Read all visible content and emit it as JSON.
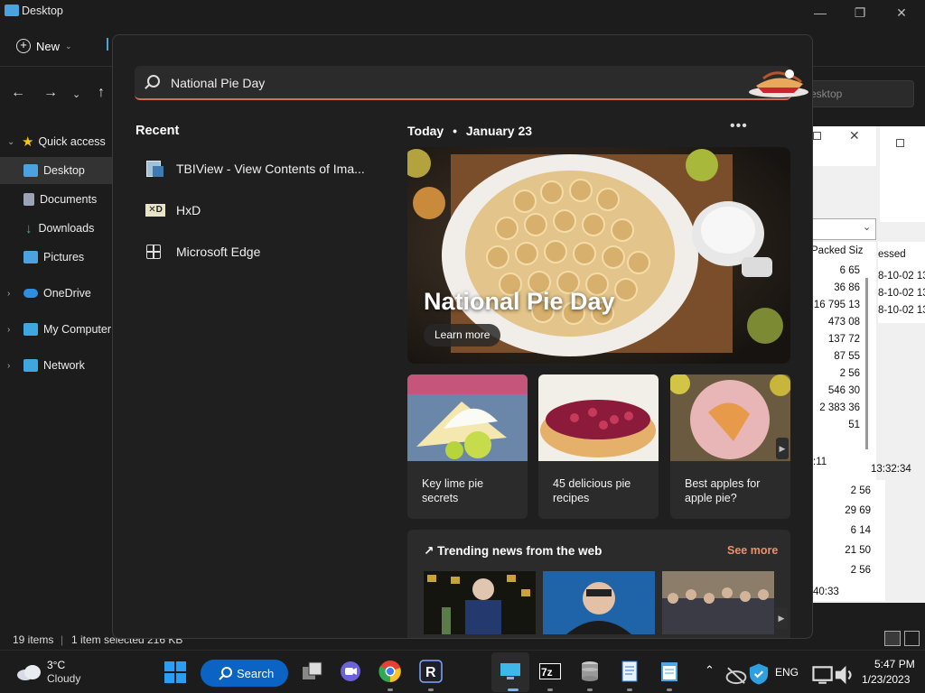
{
  "explorer": {
    "title": "Desktop",
    "new_label": "New",
    "search_placeholder": "esktop",
    "sidebar": [
      {
        "label": "Quick access",
        "icon": "star-icon",
        "color": "#f2c811"
      },
      {
        "label": "Desktop",
        "icon": "desktop-icon",
        "color": "#4aa3df"
      },
      {
        "label": "Documents",
        "icon": "documents-icon",
        "color": "#9aa4b4"
      },
      {
        "label": "Downloads",
        "icon": "download-icon",
        "color": "#3fb37f"
      },
      {
        "label": "Pictures",
        "icon": "pictures-icon",
        "color": "#4aa3df"
      },
      {
        "label": "OneDrive",
        "icon": "cloud-icon",
        "color": "#2f8ee0"
      },
      {
        "label": "My Computer",
        "icon": "computer-icon",
        "color": "#3fa7e0"
      },
      {
        "label": "Network",
        "icon": "network-icon",
        "color": "#3fa7e0"
      }
    ],
    "status": {
      "items": "19 items",
      "selected": "1 item selected",
      "size": "216 KB"
    }
  },
  "zip_window": {
    "col_packed": "Packed Siz",
    "col_modified": "essed",
    "packed_values": [
      "6 65",
      "36 86",
      "16 795 13",
      "473 08",
      "137 72",
      "87 55",
      "2 56",
      "546 30",
      "2 383 36",
      "51"
    ],
    "dates": [
      "8-10-02 13",
      "8-10-02 13",
      "8-10-02 13"
    ],
    "footer_left": ":11",
    "footer_right": "13:32:34",
    "lower_values": [
      "2 56",
      "29 69",
      "6 14",
      "21 50",
      "2 56"
    ],
    "lower_footer": "40:33"
  },
  "search": {
    "query": "National Pie Day",
    "recent_title": "Recent",
    "recent": [
      {
        "label": "TBIView - View Contents of Ima...",
        "icon": "tbiview-icon"
      },
      {
        "label": "HxD",
        "icon": "hxd-icon"
      },
      {
        "label": "Microsoft Edge",
        "icon": "edge-icon"
      }
    ],
    "today_label": "Today",
    "date_label": "January 23",
    "hero": {
      "title": "National Pie Day",
      "button": "Learn more"
    },
    "cards": [
      {
        "text": "Key lime pie secrets"
      },
      {
        "text": "45 delicious pie recipes"
      },
      {
        "text": "Best apples for apple pie?"
      }
    ],
    "trending": {
      "title": "Trending news from the web",
      "see_more": "See more"
    }
  },
  "taskbar": {
    "weather_temp": "3°C",
    "weather_desc": "Cloudy",
    "search_label": "Search",
    "language": "ENG",
    "time": "5:47 PM",
    "date": "1/23/2023",
    "accent": "#0b63c4"
  }
}
